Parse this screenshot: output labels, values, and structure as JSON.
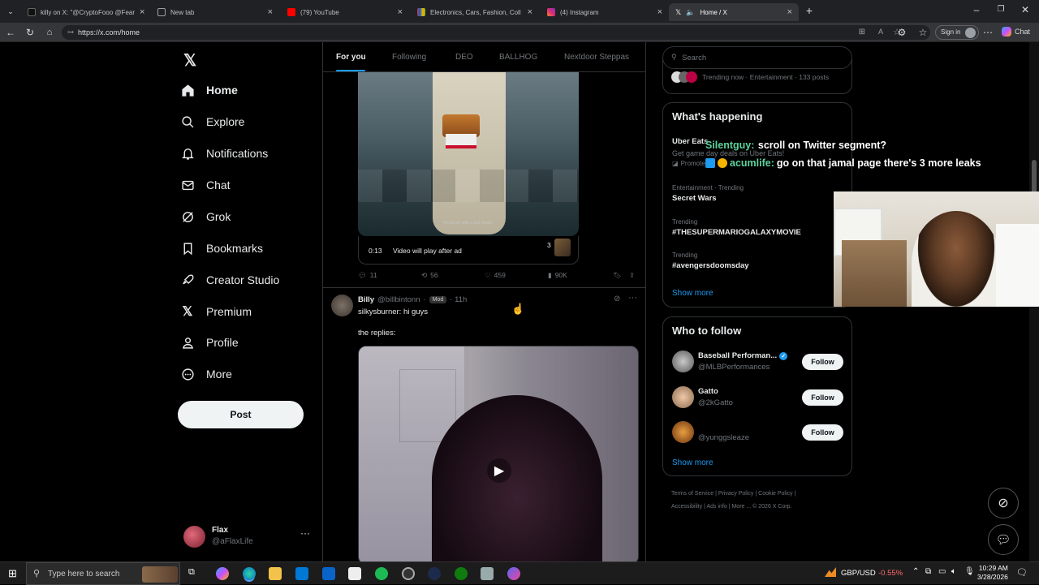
{
  "tabs": [
    {
      "label": "killy on X: \"@CryptoFooo @Fear"
    },
    {
      "label": "New tab"
    },
    {
      "label": "(79) YouTube"
    },
    {
      "label": "Electronics, Cars, Fashion, Collectib"
    },
    {
      "label": "(4) Instagram"
    },
    {
      "label": "Home / X"
    }
  ],
  "browser": {
    "url": "https://x.com/home",
    "signin": "Sign in",
    "chat": "Chat"
  },
  "nav": {
    "home": "Home",
    "explore": "Explore",
    "notifications": "Notifications",
    "chat": "Chat",
    "grok": "Grok",
    "bookmarks": "Bookmarks",
    "creator_studio": "Creator Studio",
    "premium": "Premium",
    "profile": "Profile",
    "more": "More",
    "post": "Post"
  },
  "account": {
    "name": "Flax",
    "handle": "@aFlaxLife"
  },
  "feed_tabs": [
    "For you",
    "Following",
    "DEO",
    "BALLHOG",
    "Nextdoor Steppas"
  ],
  "tweet1": {
    "time": "0:13",
    "ad_text": "Video will play after ad",
    "count": "3",
    "replies": "11",
    "reposts": "56",
    "likes": "459",
    "views": "90K",
    "watermark": "Produced with a fast model"
  },
  "tweet2": {
    "name": "Billy",
    "handle": "@billbintonn",
    "badge": "Mod",
    "time": "· 11h",
    "line1": "silkysburner: hi guys",
    "line2": "the replies:"
  },
  "search": {
    "placeholder": "Search"
  },
  "trending_now": "Trending now · Entertainment · 133 posts",
  "happening": {
    "title": "What's happening",
    "promo_name": "Uber Eats",
    "promo_desc": "Get game day deals on Uber Eats!",
    "promo_tag": "Promoted",
    "trends": [
      {
        "context": "Entertainment · Trending",
        "name": "Secret Wars"
      },
      {
        "context": "Trending",
        "name": "#THESUPERMARIOGALAXYMOVIE"
      },
      {
        "context": "Trending",
        "name": "#avengersdoomsday"
      }
    ],
    "show_more": "Show more"
  },
  "who_to_follow": {
    "title": "Who to follow",
    "accounts": [
      {
        "name": "Baseball Performan...",
        "handle": "@MLBPerformances",
        "button": "Follow"
      },
      {
        "name": "Gatto",
        "handle": "@2kGatto",
        "button": "Follow"
      },
      {
        "name": "",
        "handle": "@yunggsleaze",
        "button": "Follow"
      }
    ],
    "show_more": "Show more"
  },
  "footer": [
    "Terms of Service",
    "Privacy Policy",
    "Cookie Policy",
    "Accessibility",
    "Ads info",
    "More ...",
    "© 2026 X Corp."
  ],
  "chat_overlay": [
    {
      "user": "Silentguy:",
      "msg": "scroll on Twitter segment?"
    },
    {
      "user": "acumlife:",
      "msg": "go on that jamal page there's 3 more leaks"
    }
  ],
  "taskbar": {
    "search_placeholder": "Type here to search",
    "ticker": "GBP/USD",
    "ticker_change": "-0.55%",
    "time": "10:29 AM",
    "date": "3/28/2026"
  },
  "colors": {
    "accent": "#1d9bf0",
    "verified": "#1d9bf0",
    "down": "#f4212e"
  }
}
